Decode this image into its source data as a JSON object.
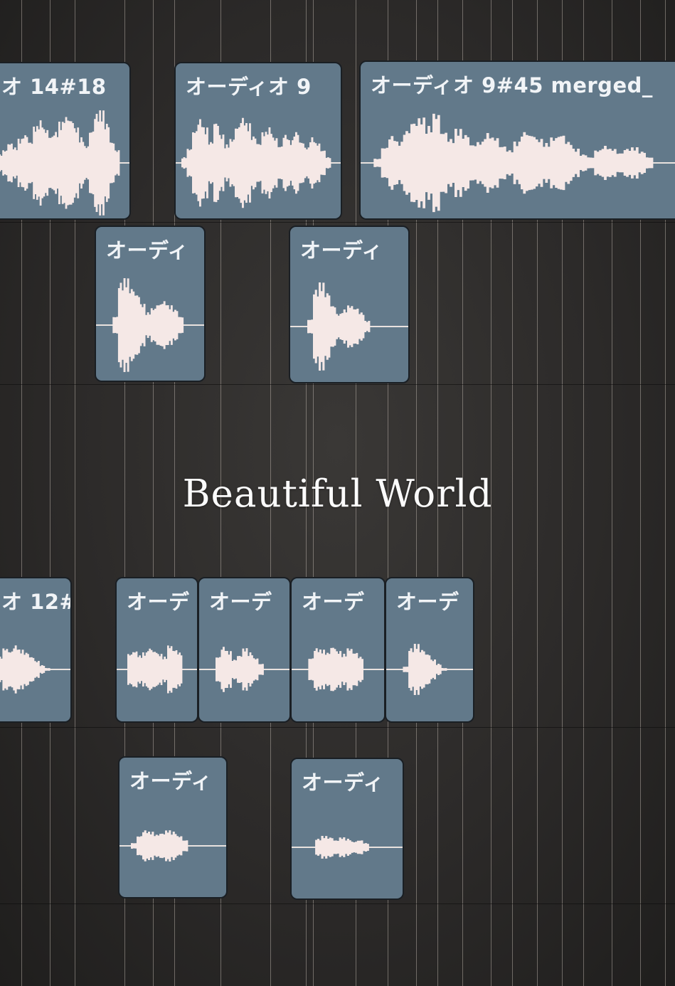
{
  "title_overlay": "Beautiful World",
  "regions": {
    "r1": "オ 14#18",
    "r2": "オーディオ 9",
    "r3": "オーディオ 9#45 merged_",
    "r4": "オーディ",
    "r5": "オーディ",
    "r6": "オ 12#",
    "r7": "オーデ",
    "r8": "オーデ",
    "r9": "オーデ",
    "r10": "オーデ",
    "r11": "オーディ",
    "r12": "オーディ"
  },
  "colors": {
    "region_fill": "#62798a",
    "waveform": "#f5e8e6",
    "background": "#2e2c2b"
  }
}
